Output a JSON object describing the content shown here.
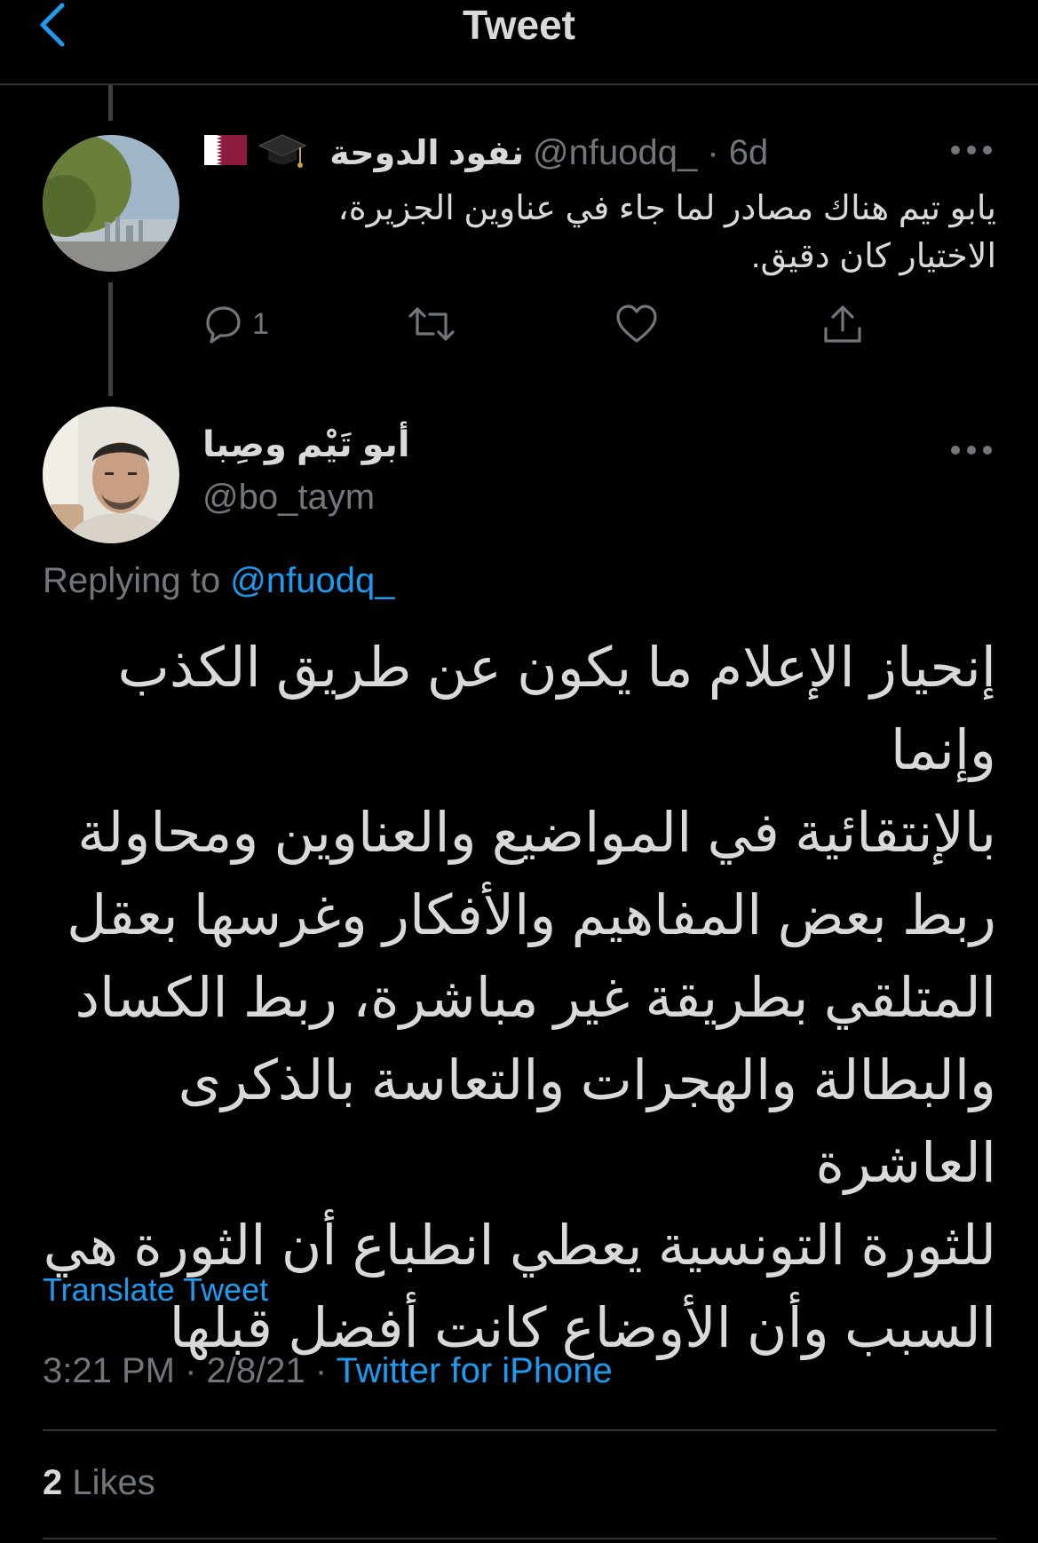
{
  "header": {
    "title": "Tweet"
  },
  "parent_tweet": {
    "display_name": "نفود الدوحة",
    "handle": "@nfuodq_",
    "time": "· 6d",
    "text_line1": "يابو تيم هناك مصادر لما جاء في عناوين الجزيرة،",
    "text_line2": "الاختيار كان دقيق.",
    "reply_count": "1",
    "emoji_icons": [
      "graduation-cap-icon",
      "qatar-flag-icon"
    ]
  },
  "main_tweet": {
    "display_name": "أبو تَيْم وصِبا",
    "handle": "@bo_taym",
    "replying_prefix": "Replying to",
    "replying_handle": "@nfuodq_",
    "lines": [
      "إنحياز الإعلام ما يكون عن طريق الكذب وإنما",
      "بالإنتقائية في المواضيع والعناوين ومحاولة",
      "ربط بعض المفاهيم والأفكار وغرسها بعقل",
      "المتلقي بطريقة غير مباشرة، ربط الكساد",
      "والبطالة والهجرات والتعاسة بالذكرى العاشرة",
      "للثورة التونسية يعطي انطباع أن الثورة هي",
      "السبب وأن الأوضاع كانت أفضل قبلها"
    ],
    "translate_label": "Translate Tweet",
    "timestamp": "3:21 PM · 2/8/21 ·",
    "source": "Twitter for iPhone",
    "likes_count": "2",
    "likes_label": "Likes"
  },
  "colors": {
    "background": "#000000",
    "text": "#d9d9d9",
    "secondary": "#71767b",
    "accent": "#1d9bf0",
    "divider": "#2f3336"
  }
}
